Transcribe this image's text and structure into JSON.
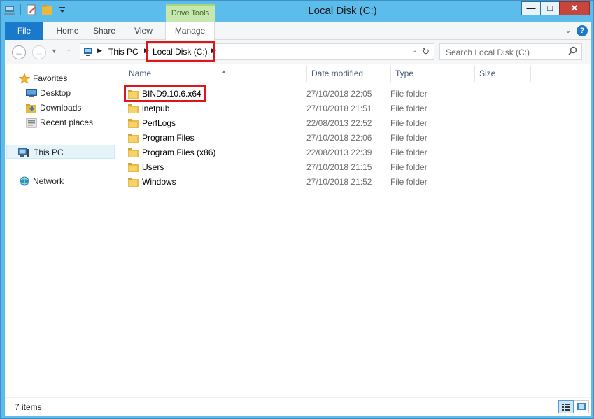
{
  "window": {
    "title": "Local Disk (C:)"
  },
  "ribbon": {
    "context_group": "Drive Tools",
    "tabs": [
      "File",
      "Home",
      "Share",
      "View",
      "Manage"
    ]
  },
  "address": {
    "crumbs": [
      "This PC",
      "Local Disk (C:)"
    ],
    "search_placeholder": "Search Local Disk (C:)"
  },
  "navpane": {
    "favorites": "Favorites",
    "items": [
      "Desktop",
      "Downloads",
      "Recent places"
    ],
    "this_pc": "This PC",
    "network": "Network"
  },
  "columns": [
    "Name",
    "Date modified",
    "Type",
    "Size"
  ],
  "files": [
    {
      "name": "BIND9.10.6.x64",
      "date": "27/10/2018 22:05",
      "type": "File folder"
    },
    {
      "name": "inetpub",
      "date": "27/10/2018 21:51",
      "type": "File folder"
    },
    {
      "name": "PerfLogs",
      "date": "22/08/2013 22:52",
      "type": "File folder"
    },
    {
      "name": "Program Files",
      "date": "27/10/2018 22:06",
      "type": "File folder"
    },
    {
      "name": "Program Files (x86)",
      "date": "22/08/2013 22:39",
      "type": "File folder"
    },
    {
      "name": "Users",
      "date": "27/10/2018 21:15",
      "type": "File folder"
    },
    {
      "name": "Windows",
      "date": "27/10/2018 21:52",
      "type": "File folder"
    }
  ],
  "status": {
    "item_count": "7 items"
  },
  "colors": {
    "frame": "#5cbcec",
    "file_tab": "#1979ca",
    "highlight": "#e0141b",
    "context_tab": "#c6e8b0"
  },
  "icons": {
    "folder": "folder-icon",
    "favorites": "star-icon",
    "desktop": "desktop-icon",
    "downloads": "downloads-icon",
    "recent": "recent-places-icon",
    "this_pc": "computer-icon",
    "network": "network-icon"
  }
}
